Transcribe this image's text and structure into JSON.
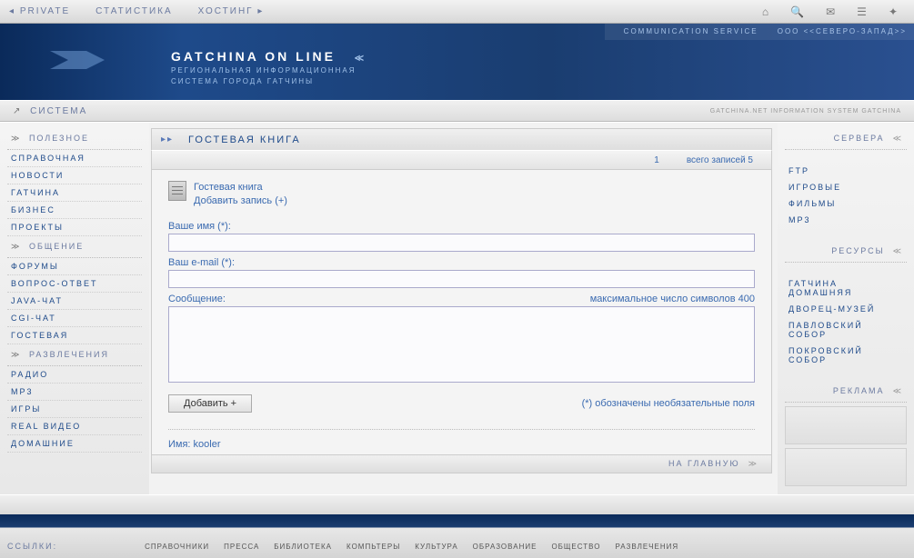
{
  "topbar": {
    "private": "PRIVATE",
    "stats": "СТАТИСТИКА",
    "hosting": "ХОСТИНГ"
  },
  "banner": {
    "comm": "COMMUNICATION   SERVICE",
    "nw": "ООО   <<СЕВЕРО-ЗАПАД>>",
    "title": "GATCHINA ON LINE",
    "sub1": "РЕГИОНАЛЬНАЯ  ИНФОРМАЦИОННАЯ",
    "sub2": "СИСТЕМА  ГОРОДА  ГАТЧИНЫ"
  },
  "sysbar": {
    "label": "СИСТЕМА",
    "note": "GATCHINA.NET  INFORMATION  SYSTEM  GATCHINA"
  },
  "left": {
    "sec1": "ПОЛЕЗНОЕ",
    "items1": [
      "СПРАВОЧНАЯ",
      "НОВОСТИ",
      "ГАТЧИНА",
      "БИЗНЕС",
      "ПРОЕКТЫ"
    ],
    "sec2": "ОБЩЕНИЕ",
    "items2": [
      "ФОРУМЫ",
      "ВОПРОС-ОТВЕТ",
      "JAVA-ЧАТ",
      "CGI-ЧАТ",
      "ГОСТЕВАЯ"
    ],
    "sec3": "РАЗВЛЕЧЕНИЯ",
    "items3": [
      "РАДИО",
      "MP3",
      "ИГРЫ",
      "REAL  ВИДЕО",
      "ДОМАШНИЕ"
    ]
  },
  "center": {
    "title": "ГОСТЕВАЯ  КНИГА",
    "page": "1",
    "total": "всего записей 5",
    "gbtitle": "Гостевая книга",
    "gbadd": "Добавить запись (+)",
    "name_label": "Ваше имя (*):",
    "email_label": "Ваш e-mail (*):",
    "msg_label": "Сообщение:",
    "maxchars": "максимальное число символов 400",
    "submit": "Добавить +",
    "required_note": "(*) обозначены необязательные поля",
    "entry_name": "Имя: kooler",
    "tomain": "НА ГЛАВНУЮ"
  },
  "right": {
    "sec1": "СЕРВЕРА",
    "items1": [
      "FTP",
      "ИГРОВЫЕ",
      "ФИЛЬМЫ",
      "MP3"
    ],
    "sec2": "РЕСУРСЫ",
    "items2": [
      "ГАТЧИНА  ДОМАШНЯЯ",
      "ДВОРЕЦ-МУЗЕЙ",
      "ПАВЛОВСКИЙ  СОБОР",
      "ПОКРОВСКИЙ  СОБОР"
    ],
    "sec3": "РЕКЛАМА"
  },
  "footer": {
    "label": "ССЫЛКИ:",
    "links": [
      "СПРАВОЧНИКИ",
      "ПРЕССА",
      "БИБЛИОТЕКА",
      "КОМПЬТЕРЫ",
      "КУЛЬТУРА",
      "ОБРАЗОВАНИЕ",
      "ОБЩЕСТВО",
      "РАЗВЛЕЧЕНИЯ"
    ]
  }
}
